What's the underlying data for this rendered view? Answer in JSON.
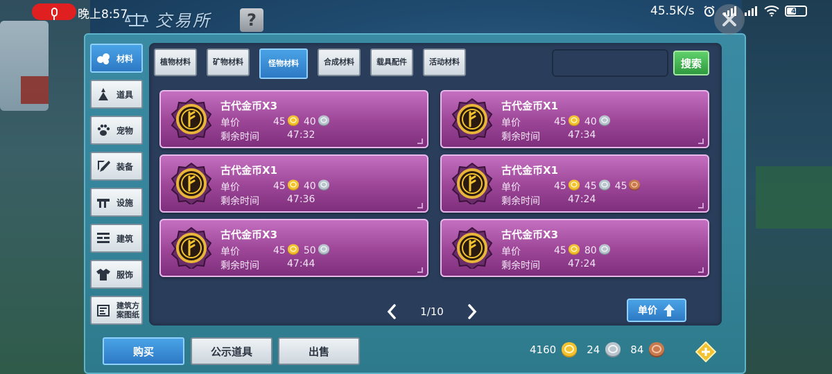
{
  "status_bar": {
    "clock": "晚上8:57",
    "net_speed": "45.5K/s",
    "battery_level": "47",
    "icons": [
      "mic-icon",
      "alarm-icon",
      "signal-icon",
      "wifi-icon",
      "battery-icon"
    ]
  },
  "header": {
    "title": "交易所",
    "help_label": "?"
  },
  "sidebar": {
    "items": [
      {
        "label": "材料",
        "icon": "materials-icon",
        "active": true
      },
      {
        "label": "道具",
        "icon": "tool-icon",
        "active": false
      },
      {
        "label": "宠物",
        "icon": "paw-icon",
        "active": false
      },
      {
        "label": "装备",
        "icon": "equipment-icon",
        "active": false
      },
      {
        "label": "设施",
        "icon": "facility-icon",
        "active": false
      },
      {
        "label": "建筑",
        "icon": "building-icon",
        "active": false
      },
      {
        "label": "服饰",
        "icon": "clothing-icon",
        "active": false
      },
      {
        "label": "建筑方案图纸",
        "icon": "blueprint-icon",
        "active": false
      }
    ]
  },
  "tabs": [
    {
      "label": "植物材料",
      "active": false
    },
    {
      "label": "矿物材料",
      "active": false
    },
    {
      "label": "怪物材料",
      "active": true
    },
    {
      "label": "合成材料",
      "active": false
    },
    {
      "label": "载具配件",
      "active": false
    },
    {
      "label": "活动材料",
      "active": false
    }
  ],
  "search": {
    "value": "",
    "placeholder": "",
    "button_label": "搜索"
  },
  "listings": [
    {
      "name": "古代金币X3",
      "price_label": "单价",
      "gold": "45",
      "silver": "40",
      "bronze": "",
      "time_label": "剩余时间",
      "time": "47:32"
    },
    {
      "name": "古代金币X1",
      "price_label": "单价",
      "gold": "45",
      "silver": "40",
      "bronze": "",
      "time_label": "剩余时间",
      "time": "47:34"
    },
    {
      "name": "古代金币X1",
      "price_label": "单价",
      "gold": "45",
      "silver": "40",
      "bronze": "",
      "time_label": "剩余时间",
      "time": "47:36"
    },
    {
      "name": "古代金币X1",
      "price_label": "单价",
      "gold": "45",
      "silver": "45",
      "bronze": "45",
      "time_label": "剩余时间",
      "time": "47:24"
    },
    {
      "name": "古代金币X3",
      "price_label": "单价",
      "gold": "45",
      "silver": "50",
      "bronze": "",
      "time_label": "剩余时间",
      "time": "47:44"
    },
    {
      "name": "古代金币X3",
      "price_label": "单价",
      "gold": "45",
      "silver": "80",
      "bronze": "",
      "time_label": "剩余时间",
      "time": "47:24"
    }
  ],
  "pagination": {
    "text": "1/10",
    "sort_label": "单价"
  },
  "bottom": {
    "buy_label": "购买",
    "showcase_label": "公示道具",
    "sell_label": "出售"
  },
  "currency": {
    "gold": "4160",
    "silver": "24",
    "bronze": "84"
  },
  "colors": {
    "accent_blue": "#2d79c4",
    "panel": "#348399",
    "card_purple": "#9c4597",
    "search_green": "#2f9a3f",
    "gold": "#f2c230",
    "silver": "#b9c4cc",
    "bronze": "#c87a4e"
  }
}
